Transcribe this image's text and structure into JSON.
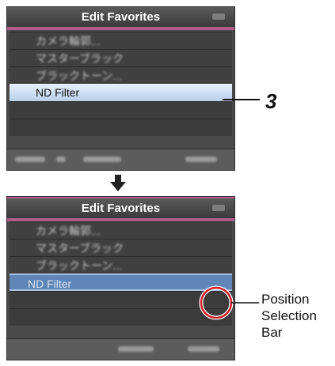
{
  "screen1": {
    "title": "Edit Favorites",
    "selected_item": "ND Filter"
  },
  "screen2": {
    "title": "Edit Favorites",
    "selected_item": "ND Filter"
  },
  "blurred_items": [
    "カメラ輪郭...",
    "マスターブラック",
    "ブラックトーン..."
  ],
  "callouts": {
    "step_number": "3",
    "position_bar_label": [
      "Position",
      "Selection",
      "Bar"
    ]
  },
  "colors": {
    "accent_pink": "#b45b8a",
    "selection_white": "#dce9f8",
    "selection_blue": "#5f86b7",
    "highlight_circle": "#d0202a"
  }
}
